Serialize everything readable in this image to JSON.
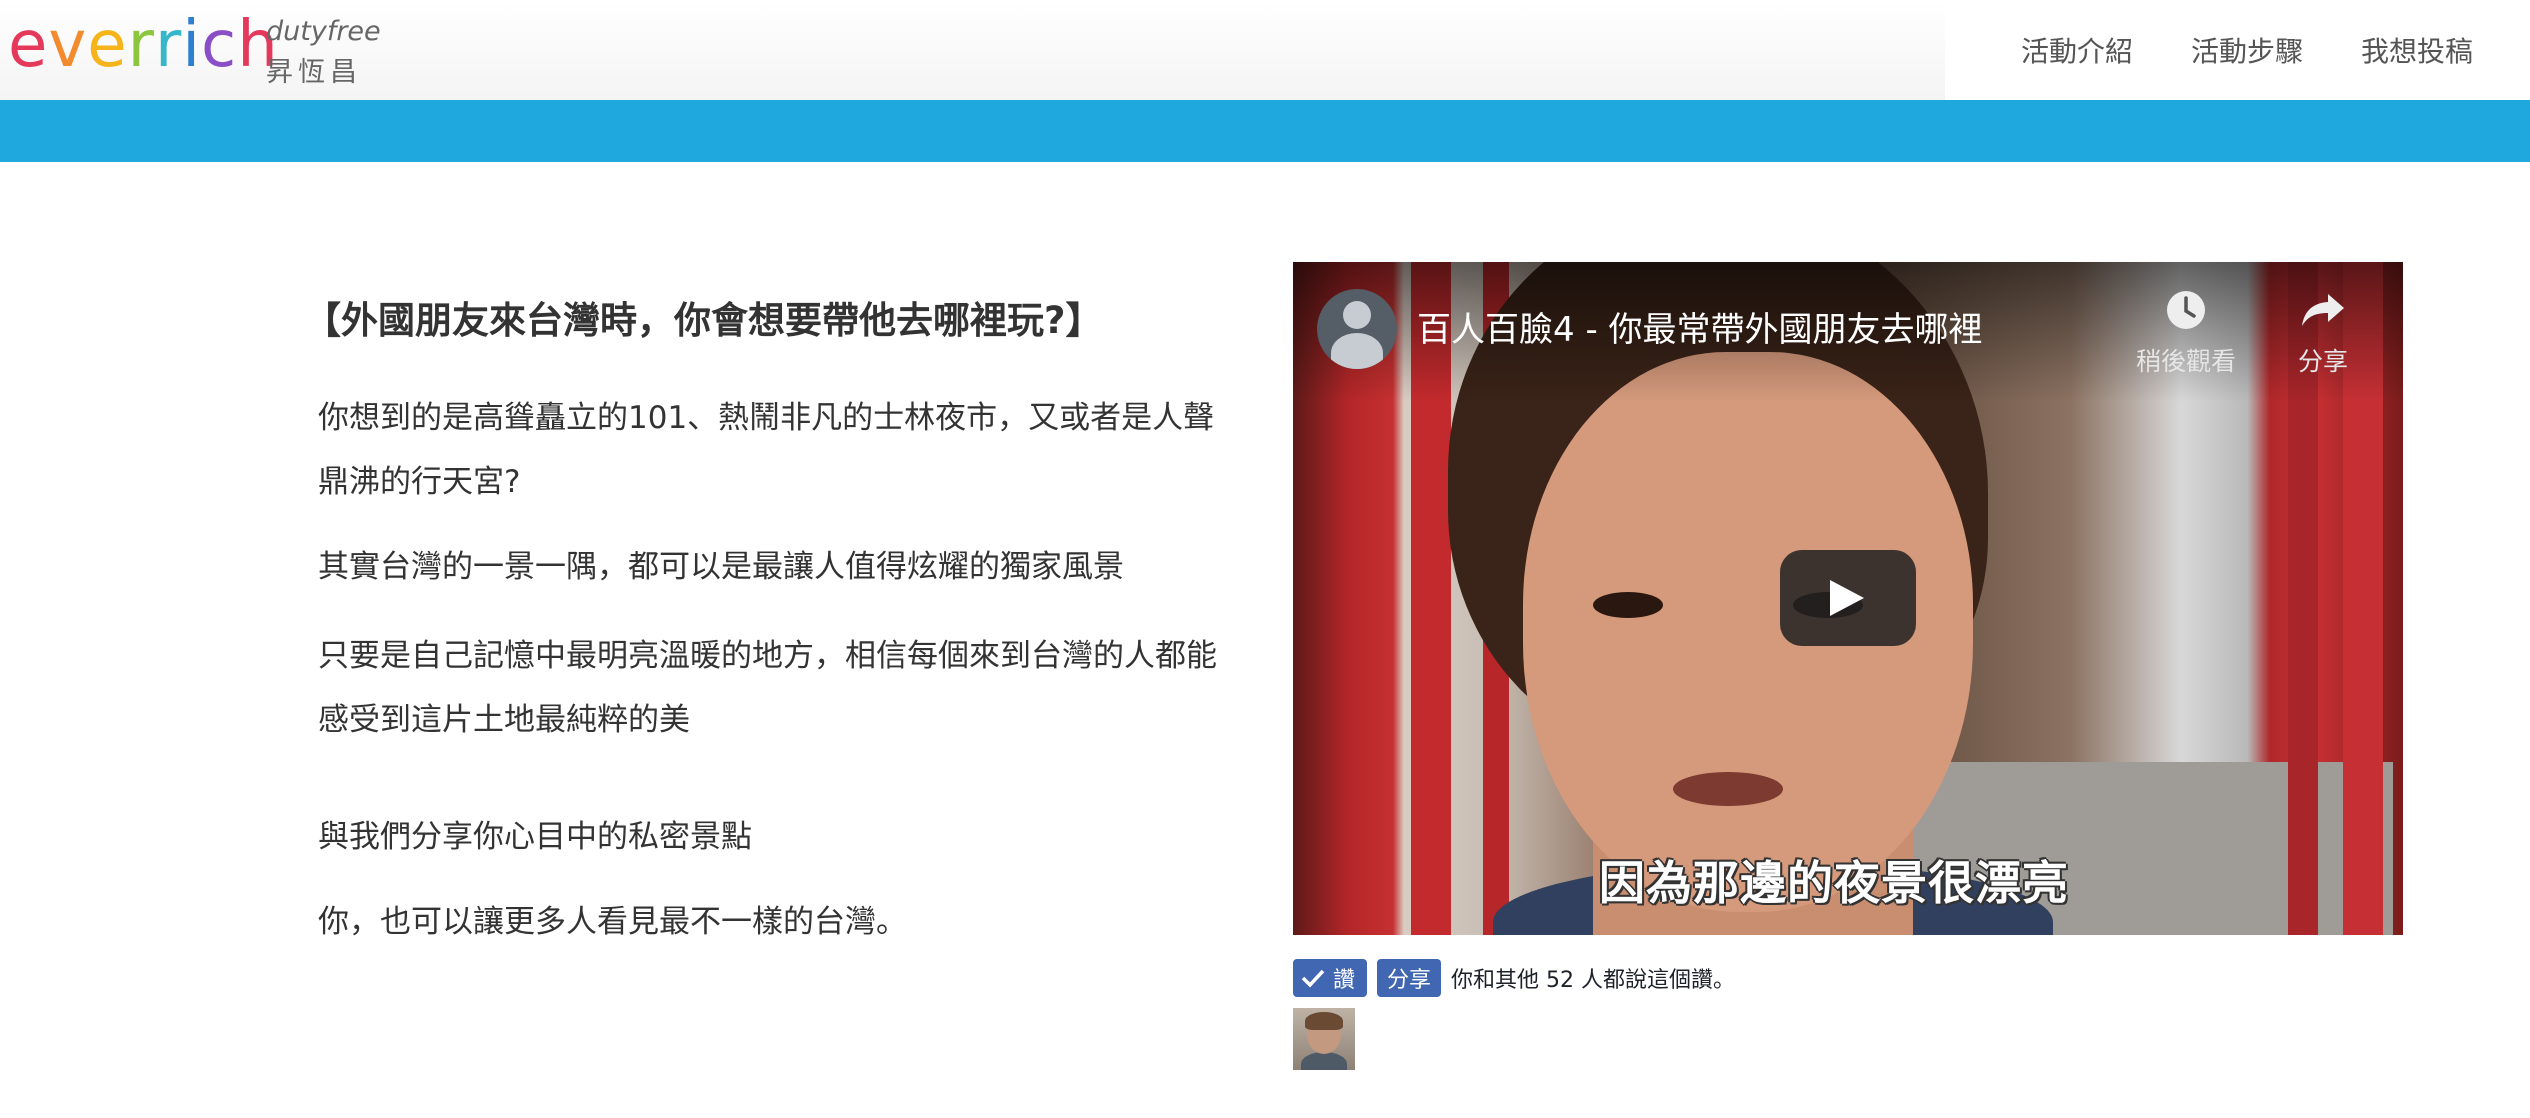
{
  "header": {
    "logo": {
      "word_letters": [
        {
          "ch": "e",
          "color": "#e5395b"
        },
        {
          "ch": "v",
          "color": "#f28a2e"
        },
        {
          "ch": "e",
          "color": "#f4b41a"
        },
        {
          "ch": "r",
          "color": "#8cc63f"
        },
        {
          "ch": "r",
          "color": "#35b7c9"
        },
        {
          "ch": "i",
          "color": "#2e7fcf"
        },
        {
          "ch": "c",
          "color": "#8a4fc6"
        },
        {
          "ch": "h",
          "color": "#e5395b"
        }
      ],
      "subtitle_en": "dutyfree",
      "subtitle_cn": "昇恆昌"
    },
    "nav": [
      "活動介紹",
      "活動步驟",
      "我想投稿"
    ]
  },
  "colors": {
    "accent_bar": "#1ea8dd",
    "facebook_blue": "#4267b2"
  },
  "intro": {
    "headline": "【外國朋友來台灣時，你會想要帶他去哪裡玩?】",
    "paragraphs": [
      "你想到的是高聳矗立的101、熱鬧非凡的士林夜市，又或者是人聲鼎沸的行天宮?",
      "其實台灣的一景一隅，都可以是最讓人值得炫耀的獨家風景",
      "只要是自己記憶中最明亮溫暖的地方，相信每個來到台灣的人都能感受到這片土地最純粹的美",
      "與我們分享你心目中的私密景點",
      "你，也可以讓更多人看見最不一樣的台灣。"
    ]
  },
  "video": {
    "title": "百人百臉4 - 你最常帶外國朋友去哪裡",
    "watch_later_label": "稍後觀看",
    "share_label": "分享",
    "subtitle": "因為那邊的夜景很漂亮",
    "icons": [
      "channel-avatar-icon",
      "clock-icon",
      "share-arrow-icon",
      "play-icon"
    ]
  },
  "facebook": {
    "like_label": "讚",
    "share_label": "分享",
    "summary": "你和其他 52 人都說這個讚。"
  }
}
